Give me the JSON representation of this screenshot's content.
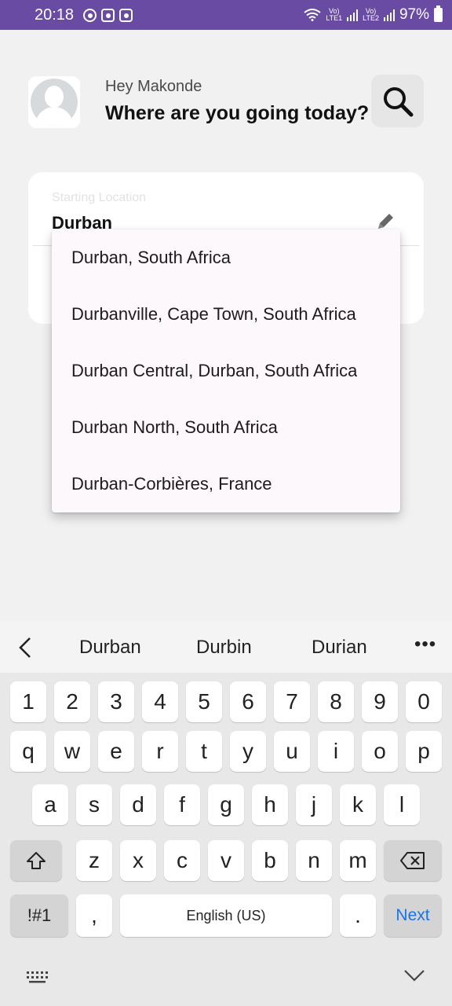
{
  "status_bar": {
    "time": "20:18",
    "lte1": "Vo)\nLTE1",
    "lte2": "Vo)\nLTE2",
    "battery": "97%"
  },
  "header": {
    "greeting": "Hey Makonde",
    "title": "Where are you going today?"
  },
  "location_card": {
    "label": "Starting Location",
    "value": "Durban"
  },
  "dropdown": {
    "items": [
      "Durban, South Africa",
      "Durbanville, Cape Town, South Africa",
      "Durban Central, Durban, South Africa",
      "Durban North, South Africa",
      "Durban-Corbières, France"
    ]
  },
  "suggestions": {
    "words": [
      "Durban",
      "Durbin",
      "Durian"
    ],
    "more": "•••"
  },
  "keyboard": {
    "numbers": [
      "1",
      "2",
      "3",
      "4",
      "5",
      "6",
      "7",
      "8",
      "9",
      "0"
    ],
    "row1": [
      "q",
      "w",
      "e",
      "r",
      "t",
      "y",
      "u",
      "i",
      "o",
      "p"
    ],
    "row2": [
      "a",
      "s",
      "d",
      "f",
      "g",
      "h",
      "j",
      "k",
      "l"
    ],
    "row3": [
      "z",
      "x",
      "c",
      "v",
      "b",
      "n",
      "m"
    ],
    "symbols": "!#1",
    "comma": ",",
    "space": "English (US)",
    "period": ".",
    "next": "Next"
  },
  "colors": {
    "status_bar": "#6a4ba4",
    "next_key": "#1a73e8"
  }
}
